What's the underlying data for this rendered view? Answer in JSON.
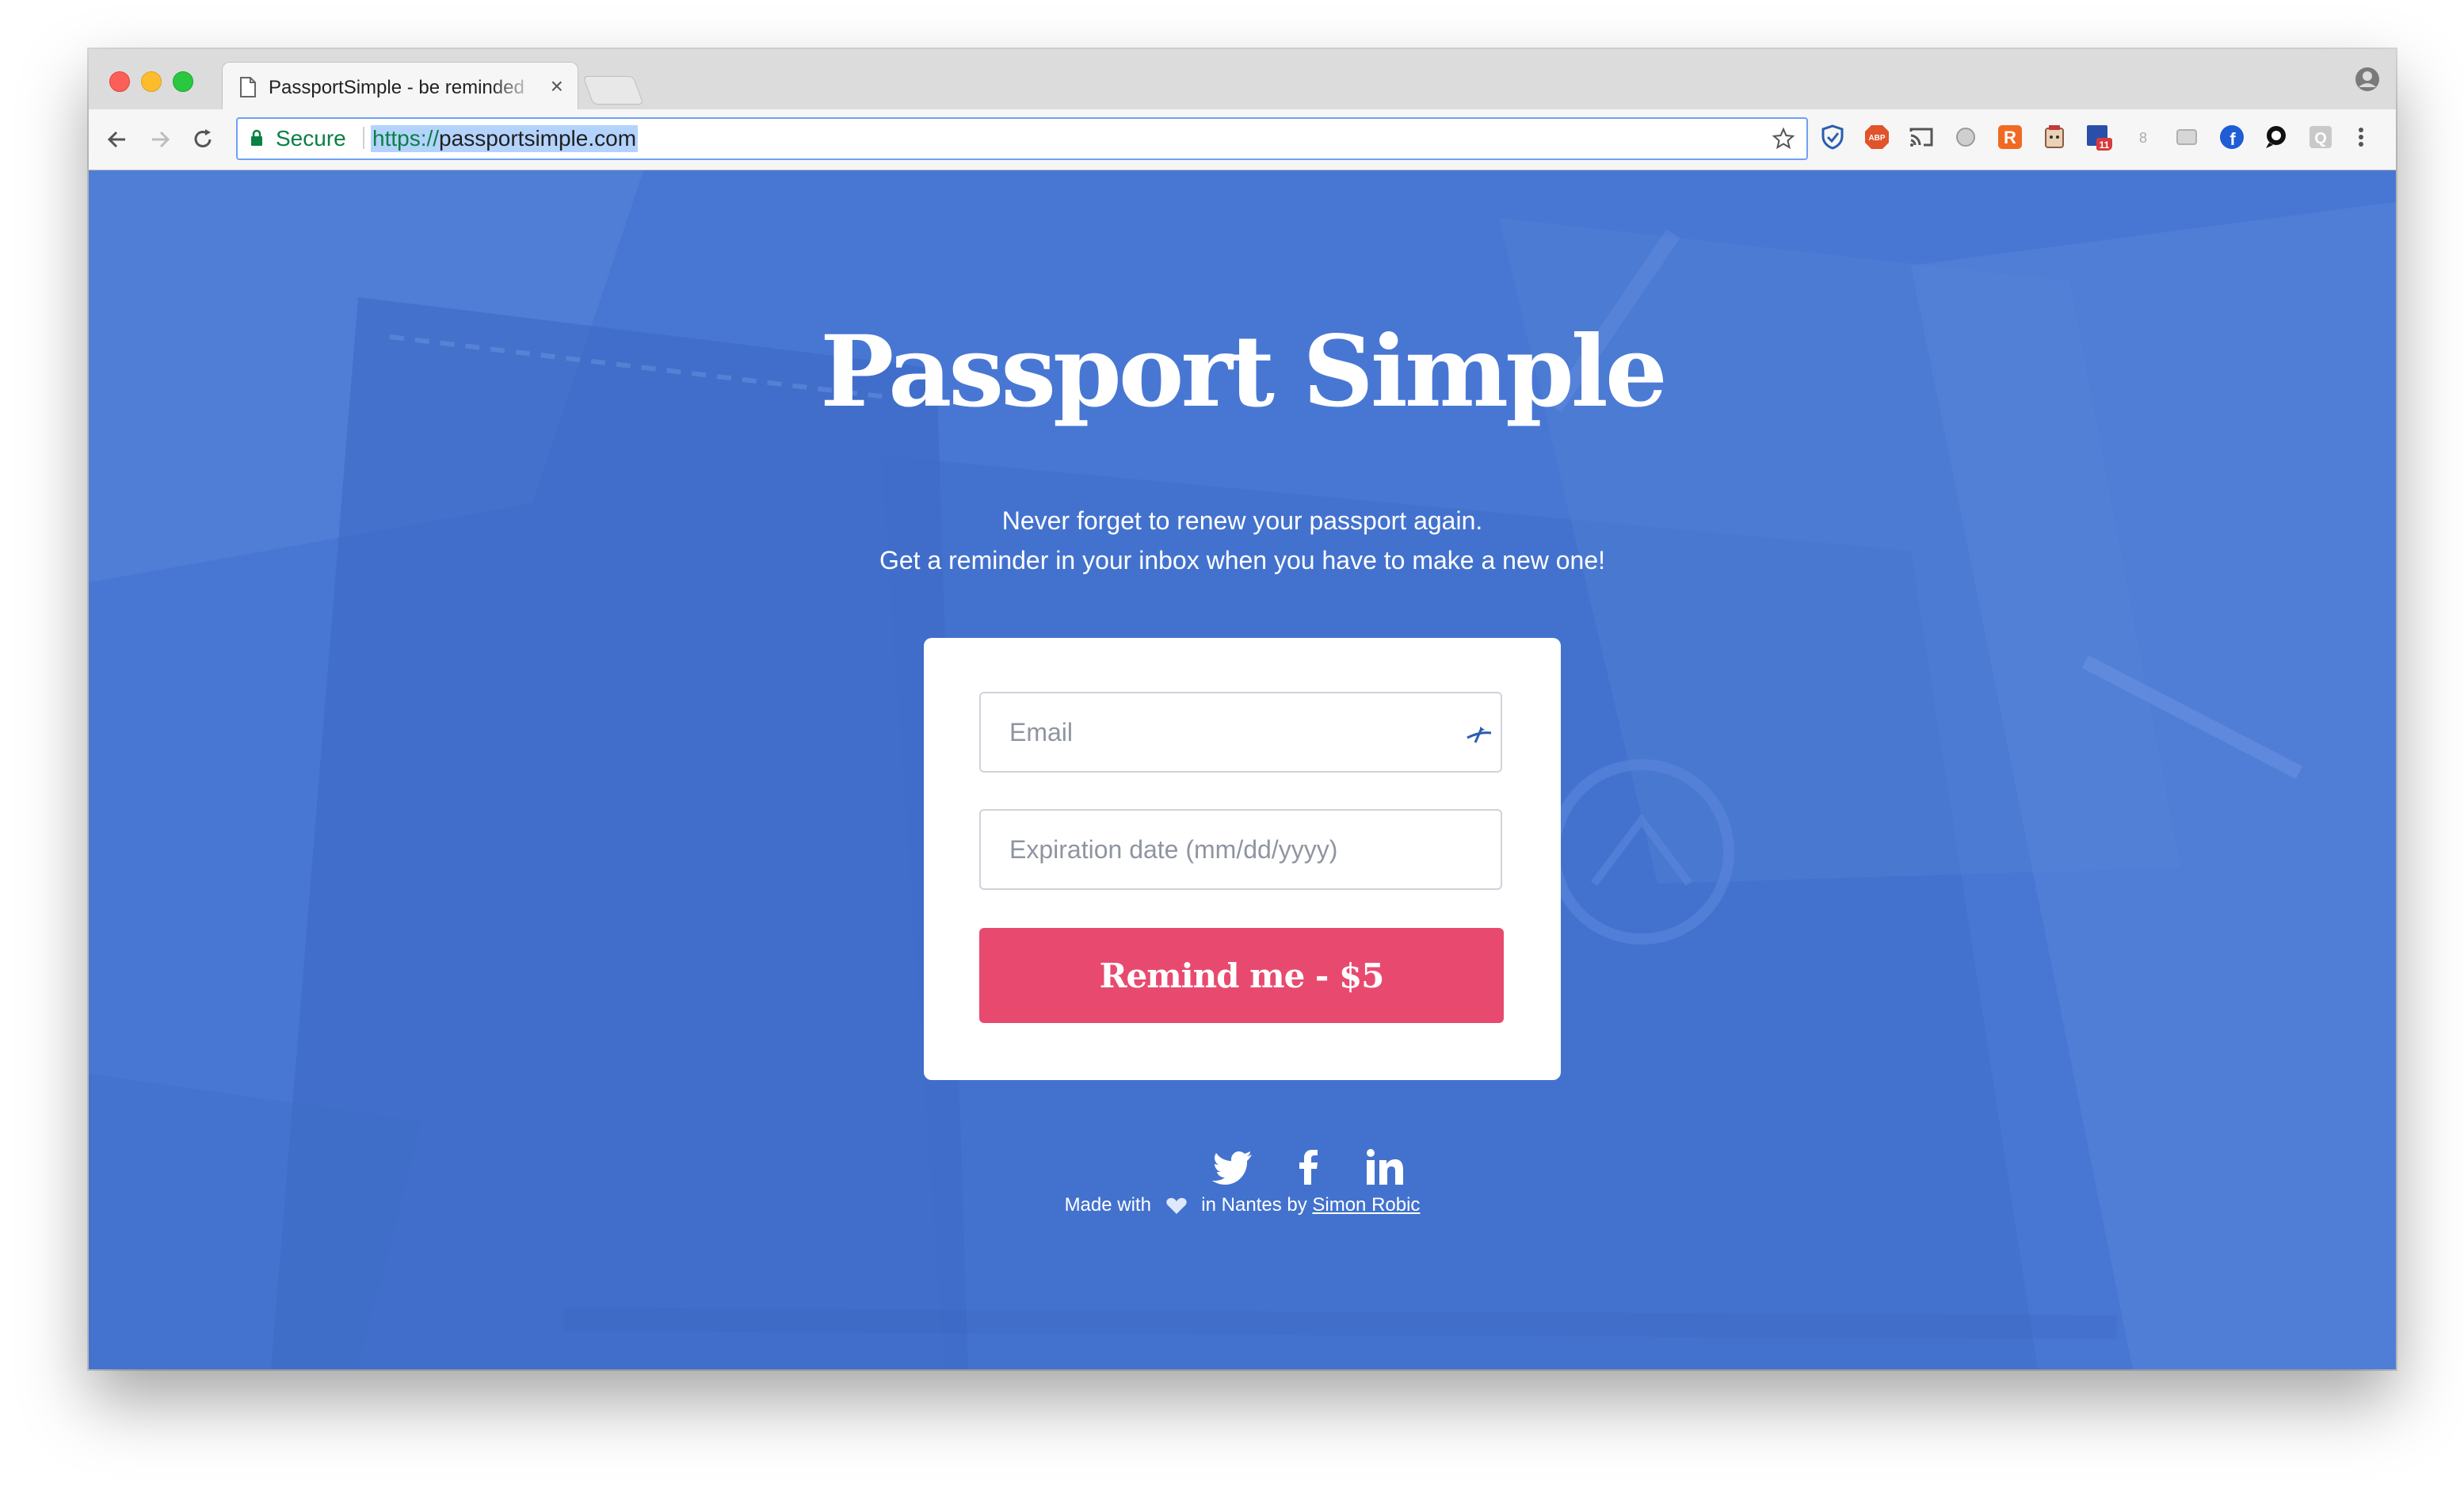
{
  "browser": {
    "tab_title": "PassportSimple - be reminded",
    "close_glyph": "×",
    "secure_label": "Secure",
    "url_scheme": "https://",
    "url_host": "passportsimple.com",
    "extension_badge": "11",
    "extension_count": "8",
    "extension_abp_label": "ABP",
    "extension_r_label": "R",
    "extension_q_label": "Q",
    "extension_f_label": "f",
    "extension_icons": [
      "shield-check-icon",
      "adblock-plus-icon",
      "cast-icon",
      "circle-icon",
      "r-extension-icon",
      "face-extension-icon",
      "calendar-badge-icon",
      "count-icon",
      "screen-icon",
      "facebook-icon",
      "speech-icon",
      "q-extension-icon",
      "more-vert-icon"
    ]
  },
  "hero": {
    "title": "Passport Simple",
    "tagline_line1": "Never forget to renew your passport again.",
    "tagline_line2": "Get a reminder in your inbox when you have to make a new one!"
  },
  "form": {
    "email_placeholder": "Email",
    "expiry_placeholder": "Expiration date (mm/dd/yyyy)",
    "submit_label": "Remind me - $5"
  },
  "social": [
    "twitter-icon",
    "facebook-icon",
    "linkedin-icon"
  ],
  "footer": {
    "made_with": "Made with",
    "in_nantes_by": "in Nantes by",
    "author": "Simon Robic"
  },
  "colors": {
    "page_bg": "#4877d3",
    "cta": "#e84a6f",
    "secure_green": "#0b8043",
    "url_highlight": "#b3d3fd"
  }
}
